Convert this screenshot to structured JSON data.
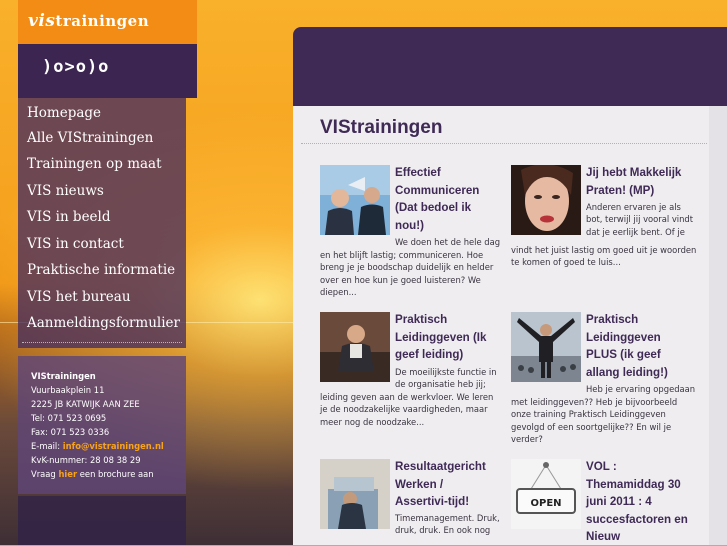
{
  "sidebar": {
    "logo": {
      "prefix": "vis",
      "suffix": "trainingen"
    },
    "emblem": ")o>o)o",
    "nav": [
      {
        "label": "Homepage"
      },
      {
        "label": "Alle VIStrainingen"
      },
      {
        "label": "Trainingen op maat"
      },
      {
        "label": "VIS nieuws"
      },
      {
        "label": "VIS in beeld"
      },
      {
        "label": "VIS in contact"
      },
      {
        "label": "Praktische informatie"
      },
      {
        "label": "VIS het bureau"
      },
      {
        "label": "Aanmeldingsformulier"
      }
    ],
    "contact": {
      "name": "VIStrainingen",
      "street": "Vuurbaakplein 11",
      "city": "2225 JB KATWIJK AAN ZEE",
      "tel": "Tel: 071 523 0695",
      "fax": "Fax: 071 523 0336",
      "email_label": "E-mail:",
      "email": "info@vistrainingen.nl",
      "kvk": "KvK-nummer: 28 08 38 29",
      "brochure_pre": "Vraag",
      "brochure_link": "hier",
      "brochure_post": "een brochure aan"
    }
  },
  "main": {
    "title": "VIStrainingen",
    "articles": [
      {
        "title_lines": [
          "Effectief",
          "Communiceren",
          "(Dat bedoel ik",
          "nou!)"
        ],
        "text_lines": [
          "We doen het de hele dag",
          "en het blijft lastig; communiceren. Hoe",
          "breng je je boodschap duidelijk en helder",
          "over en hoe kun je goed luisteren? We",
          "diepen..."
        ]
      },
      {
        "title_lines": [
          "Jij hebt Makkelijk",
          "Praten! (MP)"
        ],
        "text_lines": [
          "Anderen ervaren je als",
          "bot, terwijl jij vooral vindt",
          "dat je eerlijk bent. Of je",
          "vindt het juist lastig om goed uit je woorden",
          "te komen of goed te luis..."
        ]
      },
      {
        "title_lines": [
          "Praktisch",
          "Leidinggeven (Ik",
          "geef leiding)"
        ],
        "text_lines": [
          "De moeilijkste functie in",
          "de organisatie heb jij;",
          "leiding geven aan de werkvloer. We leren",
          "je de noodzakelijke vaardigheden, maar",
          "meer nog de noodzake..."
        ]
      },
      {
        "title_lines": [
          "Praktisch",
          "Leidinggeven",
          "PLUS (ik geef",
          "allang leiding!)"
        ],
        "text_lines": [
          "Heb je ervaring opgedaan",
          "met leidinggeven?? Heb je bijvoorbeeld",
          "onze training Praktisch Leidinggeven",
          "gevolgd of een soortgelijke?? En wil je",
          "verder?"
        ]
      },
      {
        "title_lines": [
          "Resultaatgericht",
          "Werken /",
          "Assertivi-tijd!"
        ],
        "text_lines": [
          "Timemanagement. Druk,",
          "druk, druk. En ook nog"
        ]
      },
      {
        "title_lines": [
          "VOL :",
          "Themamiddag 30",
          "juni 2011 : 4",
          "succesfactoren en",
          "Nieuw"
        ],
        "sign_text": "OPEN",
        "text_lines": []
      }
    ]
  }
}
